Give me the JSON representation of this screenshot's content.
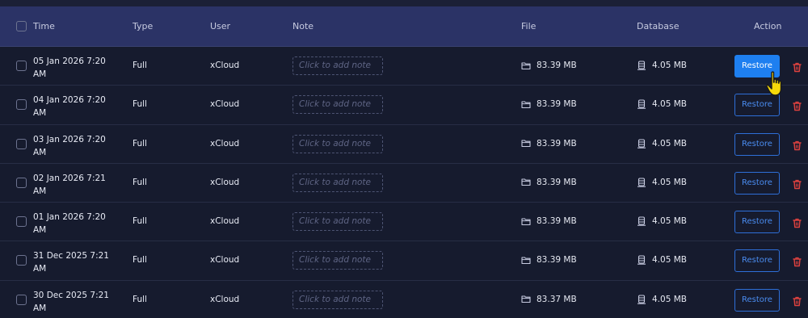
{
  "header": {
    "columns": {
      "time": "Time",
      "type": "Type",
      "user": "User",
      "note": "Note",
      "file": "File",
      "database": "Database",
      "action": "Action"
    }
  },
  "note_placeholder": "Click to add note",
  "restore_label": "Restore",
  "icons": {
    "file": "folder-icon",
    "database": "database-icon",
    "delete": "trash-icon",
    "cursor": "hand-pointer-icon"
  },
  "colors": {
    "header_bg": "#2b3366",
    "row_bg": "#161b2e",
    "primary": "#1e7ff0",
    "danger": "#e0423f"
  },
  "rows": [
    {
      "time_line1": "05 Jan 2026 7:20",
      "time_line2": "AM",
      "type": "Full",
      "user": "xCloud",
      "file_size": "83.39 MB",
      "db_size": "4.05 MB"
    },
    {
      "time_line1": "04 Jan 2026 7:20",
      "time_line2": "AM",
      "type": "Full",
      "user": "xCloud",
      "file_size": "83.39 MB",
      "db_size": "4.05 MB"
    },
    {
      "time_line1": "03 Jan 2026 7:20",
      "time_line2": "AM",
      "type": "Full",
      "user": "xCloud",
      "file_size": "83.39 MB",
      "db_size": "4.05 MB"
    },
    {
      "time_line1": "02 Jan 2026 7:21",
      "time_line2": "AM",
      "type": "Full",
      "user": "xCloud",
      "file_size": "83.39 MB",
      "db_size": "4.05 MB"
    },
    {
      "time_line1": "01 Jan 2026 7:20",
      "time_line2": "AM",
      "type": "Full",
      "user": "xCloud",
      "file_size": "83.39 MB",
      "db_size": "4.05 MB"
    },
    {
      "time_line1": "31 Dec 2025 7:21",
      "time_line2": "AM",
      "type": "Full",
      "user": "xCloud",
      "file_size": "83.39 MB",
      "db_size": "4.05 MB"
    },
    {
      "time_line1": "30 Dec 2025 7:21",
      "time_line2": "AM",
      "type": "Full",
      "user": "xCloud",
      "file_size": "83.37 MB",
      "db_size": "4.05 MB"
    }
  ]
}
